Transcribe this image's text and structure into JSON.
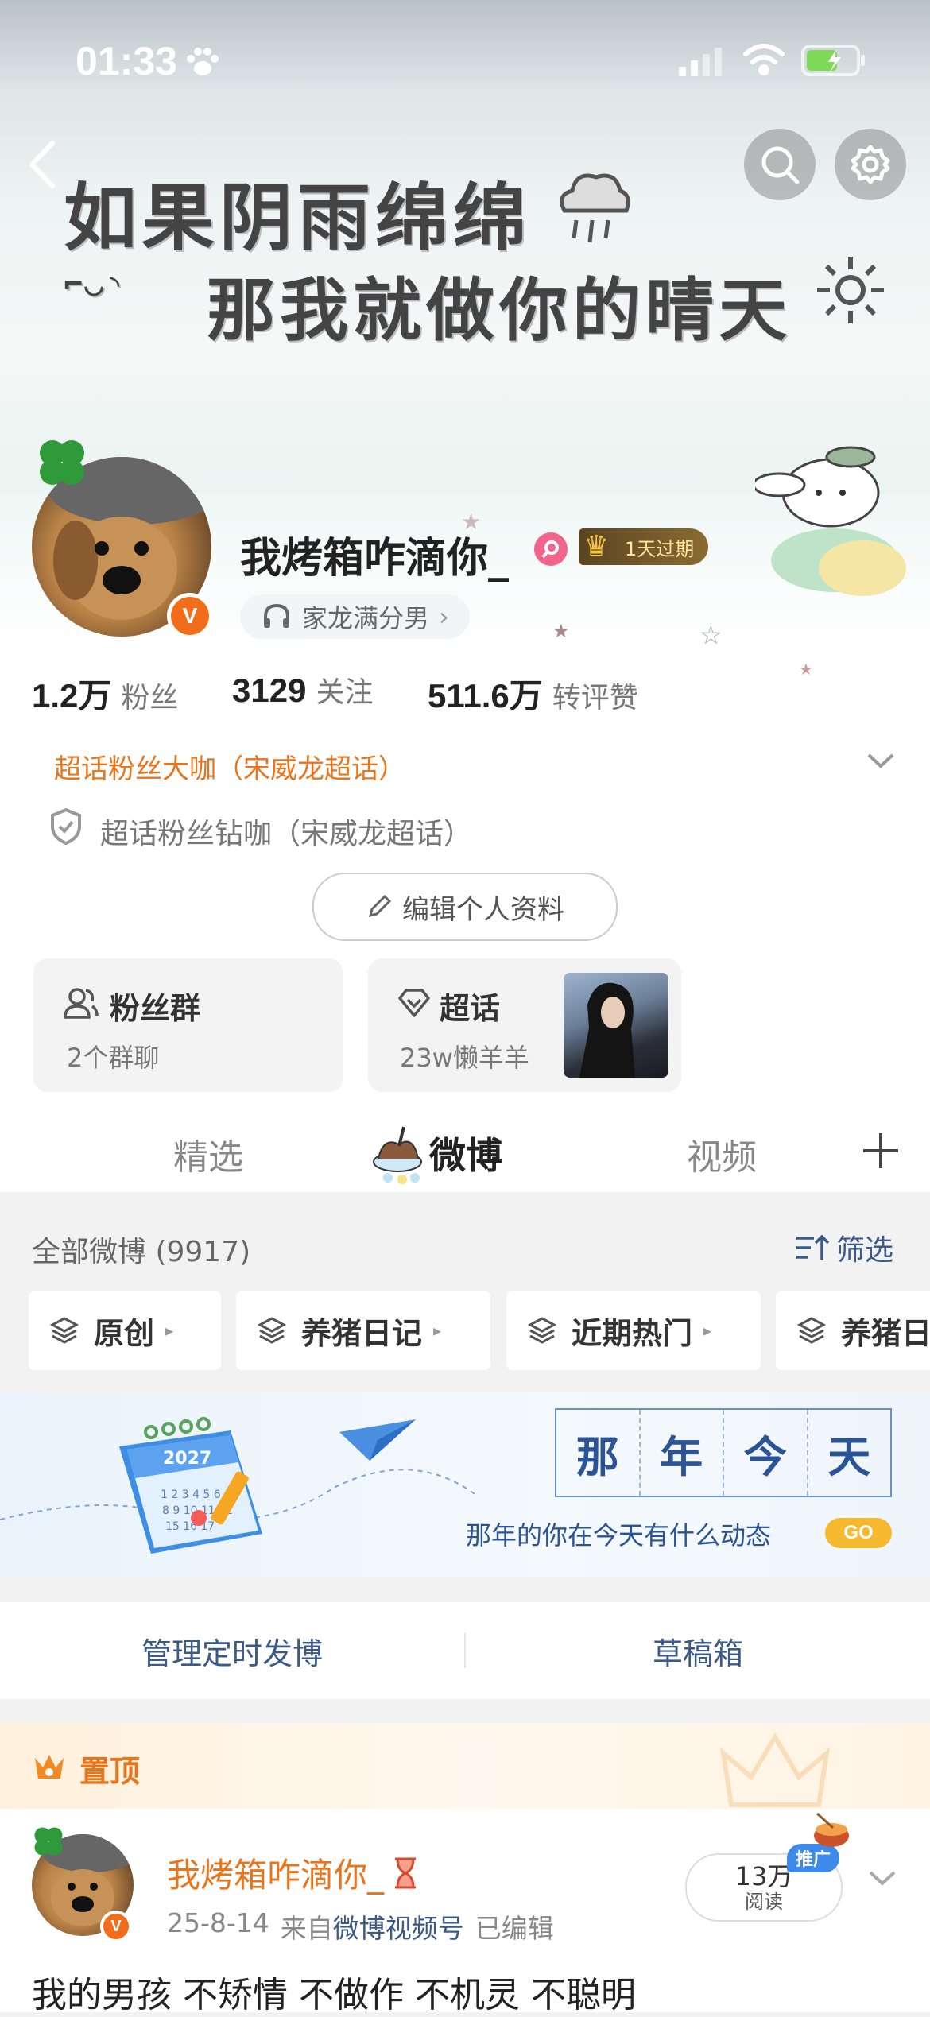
{
  "status_bar": {
    "time": "01:33"
  },
  "banner": {
    "line1": "如果阴雨绵绵",
    "line2": "那我就做你的晴天"
  },
  "profile": {
    "username": "我烤箱咋滴你_",
    "expiry_badge": "1天过期",
    "tag": "家龙满分男",
    "stats": [
      {
        "num": "1.2万",
        "label": "粉丝"
      },
      {
        "num": "3129",
        "label": "关注"
      },
      {
        "num": "511.6万",
        "label": "转评赞"
      }
    ],
    "supertopic_title": "超话粉丝大咖（宋威龙超话）",
    "supertopic_title2": "超话粉丝钻咖（宋威龙超话）",
    "edit_button": "编辑个人资料",
    "fan_group": {
      "title": "粉丝群",
      "subtitle": "2个群聊"
    },
    "supertopic_card": {
      "title": "超话",
      "subtitle": "23w懒羊羊"
    }
  },
  "tabs": {
    "items": [
      "精选",
      "微博",
      "视频"
    ],
    "active": "微博"
  },
  "feed_header": {
    "all_label": "全部微博 (9917)",
    "filter_label": "筛选"
  },
  "chips": [
    "原创",
    "养猪日记",
    "近期热门",
    "养猪日"
  ],
  "memory_banner": {
    "calendar_year": "2027",
    "title_chars": [
      "那",
      "年",
      "今",
      "天"
    ],
    "subtitle": "那年的你在今天有什么动态",
    "go_label": "GO"
  },
  "actions": {
    "scheduled": "管理定时发博",
    "drafts": "草稿箱"
  },
  "pinned": {
    "label": "置顶"
  },
  "post": {
    "author": "我烤箱咋滴你_",
    "date": "25-8-14",
    "source_prefix": "来自",
    "source": "微博视频号",
    "edited": "已编辑",
    "reads_num": "13万",
    "reads_label": "阅读",
    "promo_badge": "推广",
    "text": "我的男孩 不矫情 不做作 不机灵 不聪明"
  },
  "colors": {
    "accent_orange": "#f26d1a",
    "link_blue": "#3b5a86",
    "pin_orange": "#e8741c"
  }
}
